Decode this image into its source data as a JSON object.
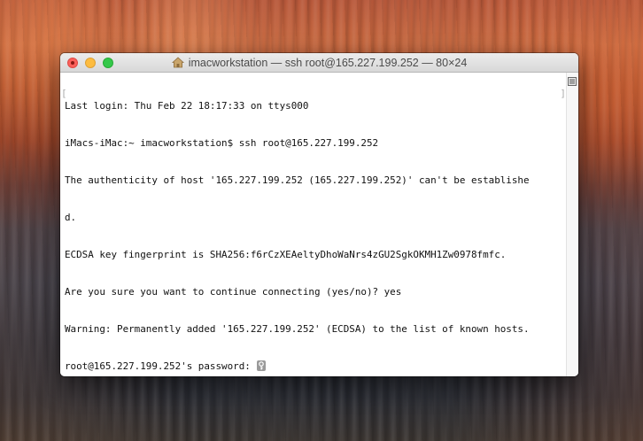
{
  "window": {
    "title": "imacworkstation — ssh root@165.227.199.252 — 80×24"
  },
  "terminal": {
    "lines": [
      "Last login: Thu Feb 22 18:17:33 on ttys000",
      "iMacs-iMac:~ imacworkstation$ ssh root@165.227.199.252",
      "The authenticity of host '165.227.199.252 (165.227.199.252)' can't be establishe",
      "d.",
      "ECDSA key fingerprint is SHA256:f6rCzXEAeltyDhoWaNrs4zGU2SgkOKMH1Zw0978fmfc.",
      "Are you sure you want to continue connecting (yes/no)? yes",
      "Warning: Permanently added '165.227.199.252' (ECDSA) to the list of known hosts.",
      "root@165.227.199.252's password: "
    ]
  },
  "colors": {
    "close": "#fc605b",
    "minimize": "#fdbc40",
    "zoom": "#34c84a"
  },
  "icons": {
    "title": "home-folder-icon",
    "cursor": "key-icon",
    "scrollbar": "split-pane-icon"
  }
}
